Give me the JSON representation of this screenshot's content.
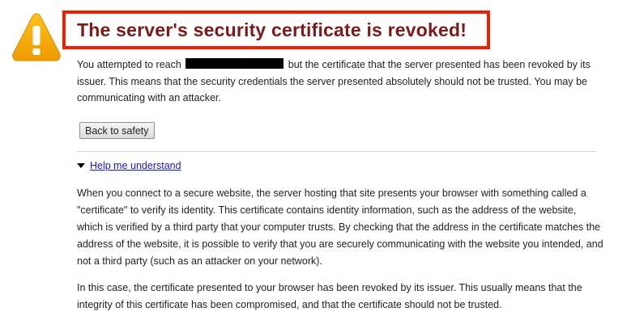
{
  "header": {
    "title": "The server's security certificate is revoked!",
    "icon": "warning-icon"
  },
  "intro": {
    "before_redaction": "You attempted to reach",
    "after_redaction": "but the certificate that the server presented has been revoked by its issuer. This means that the security credentials the server presented absolutely should not be trusted. You may be communicating with an attacker."
  },
  "actions": {
    "back_label": "Back to safety"
  },
  "help": {
    "toggle_label": "Help me understand",
    "paragraph_1": "When you connect to a secure website, the server hosting that site presents your browser with something called a \"certificate\" to verify its identity. This certificate contains identity information, such as the address of the website, which is verified by a third party that your computer trusts. By checking that the address in the certificate matches the address of the website, it is possible to verify that you are securely communicating with the website you intended, and not a third party (such as an attacker on your network).",
    "paragraph_2": "In this case, the certificate presented to your browser has been revoked by its issuer. This usually means that the integrity of this certificate has been compromised, and that the certificate should not be trusted."
  },
  "colors": {
    "title_text": "#7a1a1a",
    "title_border": "#ee2200",
    "warning_fill": "#f2a900",
    "link": "#1a1aa6"
  }
}
